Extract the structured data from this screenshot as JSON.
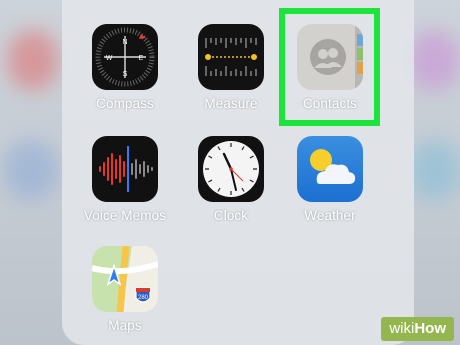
{
  "apps": [
    {
      "id": "compass",
      "label": "Compass",
      "icon": "compass-icon"
    },
    {
      "id": "measure",
      "label": "Measure",
      "icon": "measure-icon"
    },
    {
      "id": "contacts",
      "label": "Contacts",
      "icon": "contacts-icon",
      "highlighted": true
    },
    {
      "id": "voice-memos",
      "label": "Voice Memos",
      "icon": "voice-memos-icon"
    },
    {
      "id": "clock",
      "label": "Clock",
      "icon": "clock-icon"
    },
    {
      "id": "weather",
      "label": "Weather",
      "icon": "weather-icon"
    },
    {
      "id": "maps",
      "label": "Maps",
      "icon": "maps-icon",
      "road_sign": "280"
    }
  ],
  "compass": {
    "n": "N",
    "s": "S",
    "e": "E",
    "w": "W"
  },
  "watermark": {
    "brand_prefix": "wiki",
    "brand_suffix": "How"
  },
  "colors": {
    "highlight": "#1ce43b",
    "watermark_bg": "#93b64f"
  }
}
